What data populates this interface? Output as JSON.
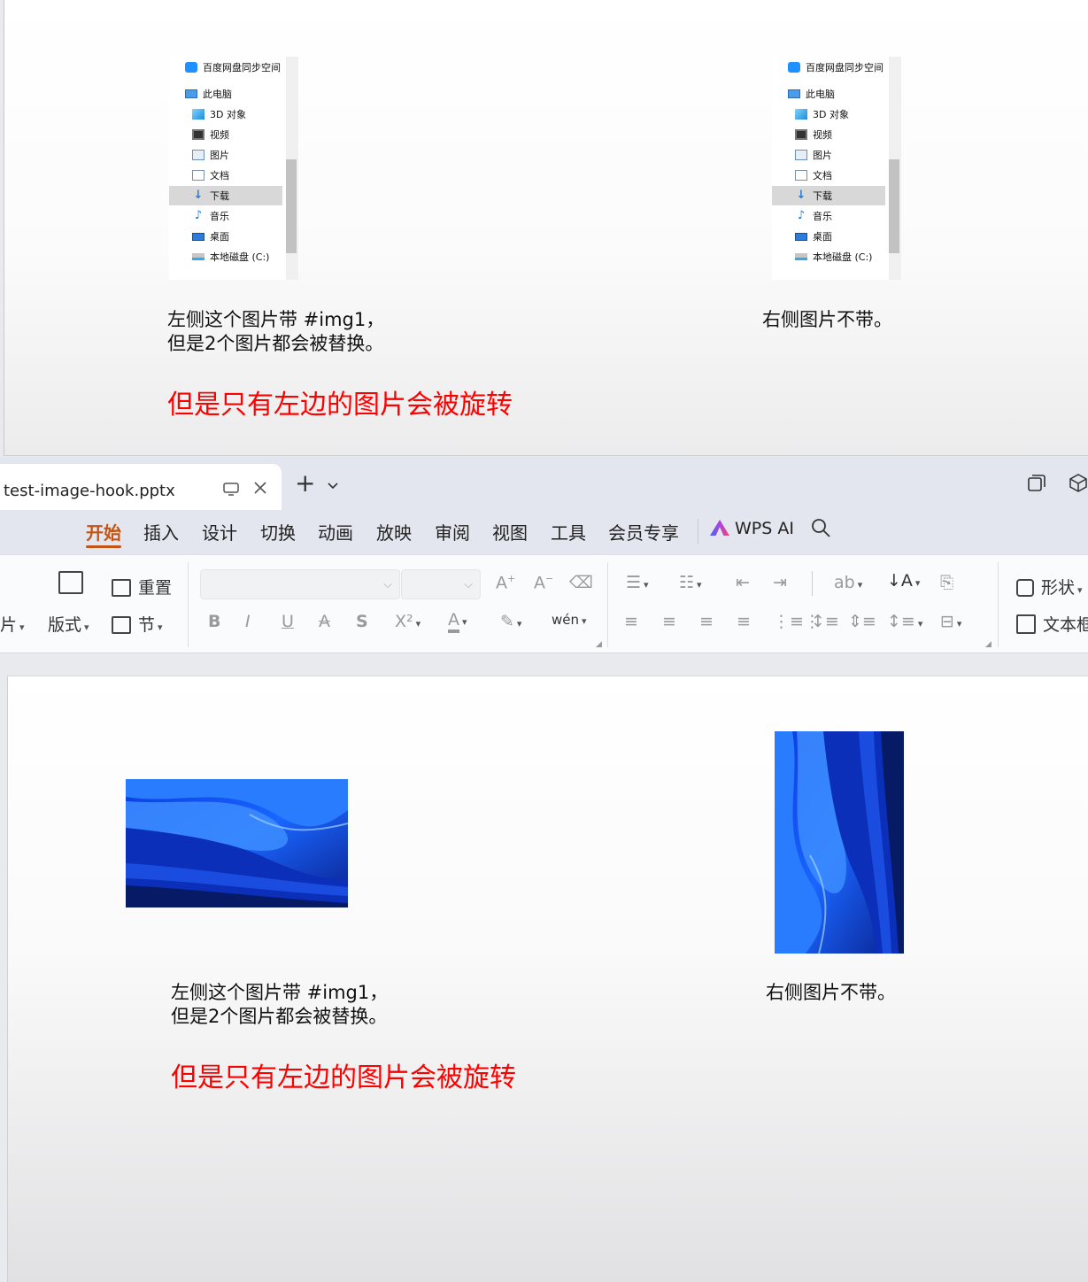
{
  "top_slide": {
    "explorer_items": [
      {
        "label": "百度网盘同步空间",
        "icon": "baidu-netdisk-icon"
      },
      {
        "label": "此电脑",
        "icon": "computer-icon"
      },
      {
        "label": "3D 对象",
        "icon": "3d-objects-icon"
      },
      {
        "label": "视频",
        "icon": "video-icon"
      },
      {
        "label": "图片",
        "icon": "pictures-icon"
      },
      {
        "label": "文档",
        "icon": "documents-icon"
      },
      {
        "label": "下载",
        "icon": "download-icon"
      },
      {
        "label": "音乐",
        "icon": "music-icon"
      },
      {
        "label": "桌面",
        "icon": "desktop-icon"
      },
      {
        "label": "本地磁盘 (C:)",
        "icon": "local-disk-icon"
      }
    ],
    "selected_item": "下载",
    "left_caption_line1": "左侧这个图片带 #img1，",
    "left_caption_line2": "但是2个图片都会被替换。",
    "right_caption": "右侧图片不带。",
    "note": "但是只有左边的图片会被旋转",
    "note_color": "#ff0000"
  },
  "tabbar": {
    "file_name": "test-image-hook.pptx",
    "monitor_icon": "monitor-icon",
    "close_icon": "close-icon",
    "new_tab": "+",
    "dropdown": "⌄"
  },
  "menu": {
    "items": [
      "开始",
      "插入",
      "设计",
      "切换",
      "动画",
      "放映",
      "审阅",
      "视图",
      "工具",
      "会员专享"
    ],
    "active": "开始",
    "accent_color": "#c25414",
    "wps_ai": "WPS AI"
  },
  "toolbar": {
    "pictures_partial": "片",
    "reset": "重置",
    "layout": "版式",
    "section": "节",
    "shape": "形状",
    "textbox": "文本框",
    "bold": "B",
    "italic": "I",
    "underline": "U",
    "strike": "A",
    "shadow": "S",
    "superscript": "X²",
    "font_color": "A",
    "phonetic": "wén"
  },
  "bottom_slide": {
    "left_caption_line1": "左侧这个图片带 #img1，",
    "left_caption_line2": "但是2个图片都会被替换。",
    "right_caption": "右侧图片不带。",
    "note": "但是只有左边的图片会被旋转",
    "note_color": "#ff0000"
  }
}
